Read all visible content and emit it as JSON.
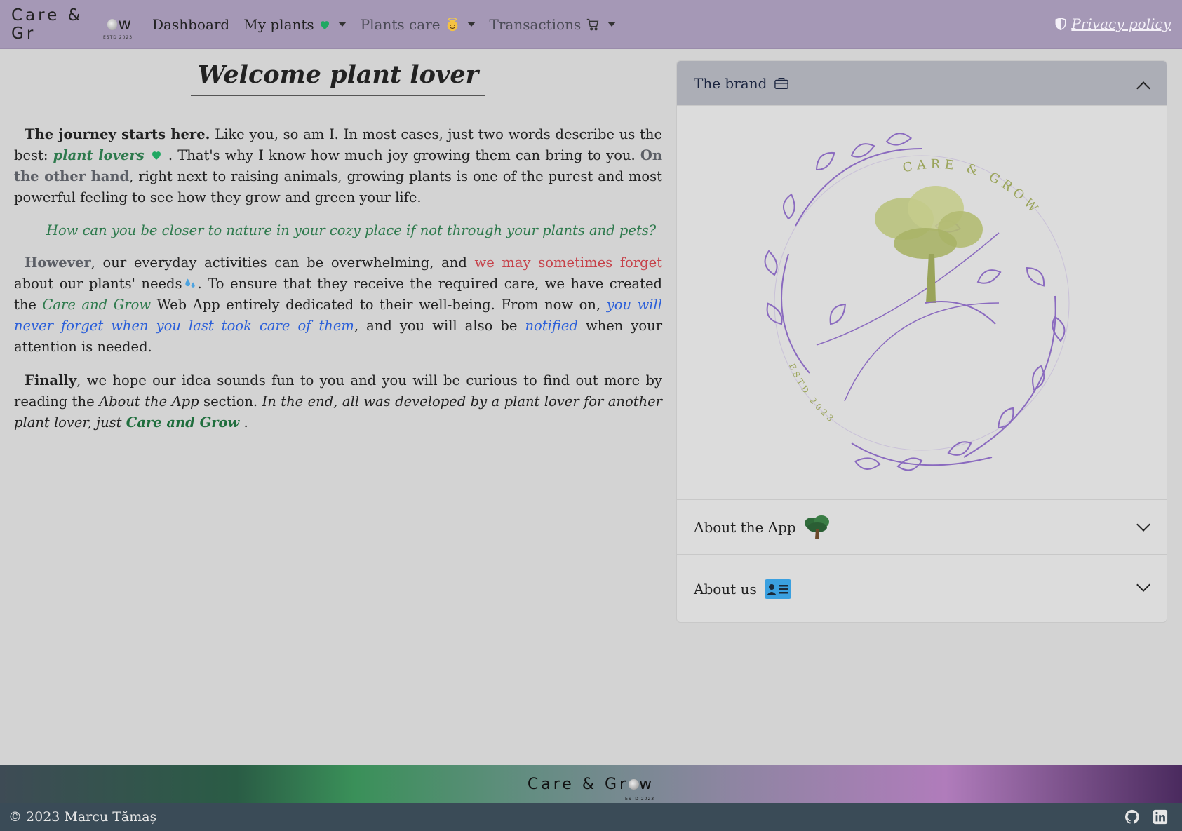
{
  "navbar": {
    "logo": {
      "text_pre": "Care & Gr",
      "text_post": "w",
      "estd": "ESTD 2023"
    },
    "links": [
      {
        "label": "Dashboard"
      },
      {
        "label": "My plants"
      },
      {
        "label": "Plants care"
      },
      {
        "label": "Transactions"
      }
    ],
    "privacy": "Privacy policy"
  },
  "main": {
    "title": "Welcome plant lover",
    "p1": {
      "strong": "The journey starts here.",
      "t1": " Like you, so am I. In most cases, just two words describe us the best: ",
      "green": "plant lovers",
      "t2": " . That's why I know how much joy growing them can bring to you. ",
      "grey": "On the other hand",
      "t3": ", right next to raising animals, growing plants is one of the purest and most powerful feeling to see how they grow and green your life."
    },
    "quote": "How can you be closer to nature in your cozy place if not through your plants and pets?",
    "p2": {
      "grey": "However",
      "t1": ", our everyday activities can be overwhelming, and ",
      "red": "we may sometimes forget",
      "t2": " about our plants' needs",
      "t3": ". To ensure that they receive the required care, we have created the ",
      "green": "Care and Grow",
      "t4": " Web App entirely dedicated to their well-being. From now on, ",
      "blue1": "you will never forget when you last took care of them",
      "t5": ", and you will also be ",
      "blue2": "notified",
      "t6": " when your attention is needed."
    },
    "p3": {
      "strong": "Finally",
      "t1": ", we hope our idea sounds fun to you and you will be curious to find out more by reading the ",
      "ital1": "About the App",
      "t2": " section. ",
      "ital2": "In the end, all was developed by a plant lover for another plant lover, just ",
      "link": "Care and Grow",
      "t3": " ."
    }
  },
  "accordion": {
    "items": [
      {
        "label": "The brand",
        "state": "expanded"
      },
      {
        "label": "About the App",
        "state": "collapsed"
      },
      {
        "label": "About us",
        "state": "collapsed"
      }
    ],
    "brand_image": {
      "ring_text": "CARE & GROW",
      "estd_text": "ESTD 2023"
    }
  },
  "footer": {
    "logo_pre": "Care & Gr",
    "logo_post": "w",
    "estd": "ESTD 2023",
    "copyright": "© 2023 Marcu Tămaș"
  },
  "colors": {
    "navbar": "#a598b6",
    "accent_green": "#2e7a4d",
    "accent_red": "#c6424a",
    "accent_blue": "#2b5fd9",
    "footer_bar": "#3a4b57"
  }
}
